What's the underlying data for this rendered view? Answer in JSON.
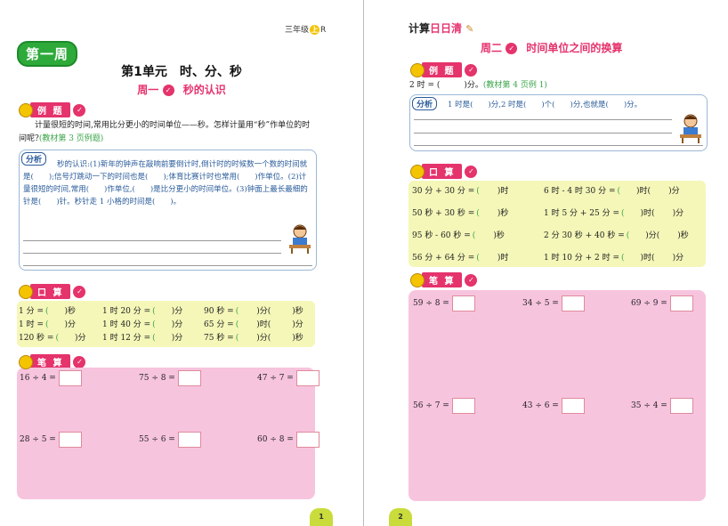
{
  "left": {
    "grade": {
      "pre": "三年级",
      "mid": "上",
      "post": "R"
    },
    "week_badge": "第一周",
    "unit_title": "第1单元　时、分、秒",
    "day_title": {
      "day": "周一",
      "topic": "秒的认识"
    },
    "example_label": "例 题",
    "example_text": "计量很短的时间,常用比分更小的时间单位——秒。怎样计量用“秒”作单位的时间呢?",
    "example_ref": "(教材第 3 页例题)",
    "fenxi_label": "分析",
    "analysis_text": "秒的认识:(1)新年的钟声在敲响前要倒计时,倒计时的时候数一个数的时间就是(　　);信号灯跳动一下的时间也是(　　);体育比赛计时也常用(　　)作单位。(2)计量很短的时间,常用(　　)作单位,(　　)是比分更小的时间单位。(3)钟面上最长最细的针是(　　)针。秒针走 1 小格的时间是(　　)。",
    "oral_label": "口 算",
    "oral": [
      [
        "1 分 =",
        "(",
        ")秒",
        "1 时 20 分 =",
        "(",
        ")分",
        "90 秒 =",
        "(",
        ")分(",
        ")秒"
      ],
      [
        "1 时 =",
        "(",
        ")分",
        "1 时 40 分 =",
        "(",
        ")分",
        "65 分 =",
        "(",
        ")时(",
        ")分"
      ],
      [
        "120 秒 =",
        "(",
        ")分",
        "1 时 12 分 =",
        "(",
        ")分",
        "75 秒 =",
        "(",
        ")分(",
        ")秒"
      ]
    ],
    "written_label": "笔 算",
    "written": [
      "16 ÷ 4 =",
      "75 ÷ 8 =",
      "47 ÷ 7 =",
      "28 ÷ 5 =",
      "55 ÷ 6 =",
      "60 ÷ 8 ="
    ],
    "page_no": "1"
  },
  "right": {
    "calc_title": {
      "a": "计算",
      "b": "日日清"
    },
    "day_title": {
      "day": "周二",
      "topic": "时间单位之间的换算"
    },
    "example_label": "例 题",
    "example_q": "2 时 = (　　　)分。",
    "example_ref": "(教材第 4 页例 1)",
    "fenxi_label": "分析",
    "analysis_text": "1 时是(　　)分,2 时是(　　)个(　　)分,也就是(　　)分。",
    "oral_label": "口 算",
    "oral": [
      [
        "30 分 + 30 分 =",
        "(",
        ")时",
        "6 时 - 4 时 30 分 =",
        "(",
        ")时(",
        ")分"
      ],
      [
        "50 秒 + 30 秒 =",
        "(",
        ")秒",
        "1 时 5 分 + 25 分 =",
        "(",
        ")时(",
        ")分"
      ],
      [
        "95 秒 - 60 秒 =",
        "(",
        ")秒",
        "2 分 30 秒 + 40 秒 =",
        "(",
        ")分(",
        ")秒"
      ],
      [
        "56 分 + 64 分 =",
        "(",
        ")时",
        "1 时 10 分 + 2 时 =",
        "(",
        ")时(",
        ")分"
      ]
    ],
    "written_label": "笔 算",
    "written": [
      "59 ÷ 8 =",
      "34 ÷ 5 =",
      "69 ÷ 9 =",
      "56 ÷ 7 =",
      "43 ÷ 6 =",
      "35 ÷ 4 ="
    ],
    "page_no": "2"
  }
}
